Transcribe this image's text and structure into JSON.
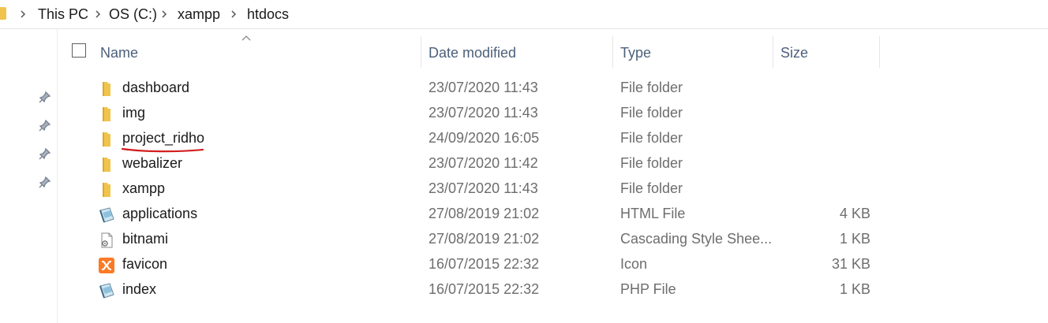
{
  "breadcrumb": {
    "items": [
      "This PC",
      "OS (C:)",
      "xampp",
      "htdocs"
    ]
  },
  "columns": {
    "name": "Name",
    "date_modified": "Date modified",
    "type": "Type",
    "size": "Size"
  },
  "files": [
    {
      "name": "dashboard",
      "date": "23/07/2020 11:43",
      "type": "File folder",
      "size": "",
      "icon": "folder-icon"
    },
    {
      "name": "img",
      "date": "23/07/2020 11:43",
      "type": "File folder",
      "size": "",
      "icon": "folder-icon"
    },
    {
      "name": "project_ridho",
      "date": "24/09/2020 16:05",
      "type": "File folder",
      "size": "",
      "icon": "folder-icon"
    },
    {
      "name": "webalizer",
      "date": "23/07/2020 11:42",
      "type": "File folder",
      "size": "",
      "icon": "folder-icon"
    },
    {
      "name": "xampp",
      "date": "23/07/2020 11:43",
      "type": "File folder",
      "size": "",
      "icon": "folder-icon"
    },
    {
      "name": "applications",
      "date": "27/08/2019 21:02",
      "type": "HTML File",
      "size": "4 KB",
      "icon": "html-file-icon"
    },
    {
      "name": "bitnami",
      "date": "27/08/2019 21:02",
      "type": "Cascading Style Shee...",
      "size": "1 KB",
      "icon": "css-file-icon"
    },
    {
      "name": "favicon",
      "date": "16/07/2015 22:32",
      "type": "Icon",
      "size": "31 KB",
      "icon": "xampp-icon"
    },
    {
      "name": "index",
      "date": "16/07/2015 22:32",
      "type": "PHP File",
      "size": "1 KB",
      "icon": "php-file-icon"
    }
  ],
  "colors": {
    "folder": "#f0c44c",
    "header_text": "#4c607a",
    "annotation": "#d21f1f",
    "xampp": "#fb7a24"
  }
}
